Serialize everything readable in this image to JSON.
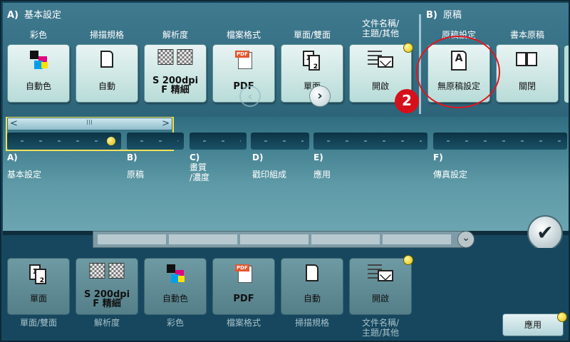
{
  "top": {
    "section_a": {
      "letter": "A)",
      "title": "基本設定"
    },
    "section_b": {
      "letter": "B)",
      "title": "原稿"
    },
    "buttons": [
      {
        "title": "彩色",
        "value": "自動色"
      },
      {
        "title": "掃描規格",
        "value": "自動"
      },
      {
        "title": "解析度",
        "value1": "S 200dpi",
        "value2": "F 精細"
      },
      {
        "title": "檔案格式",
        "value": "PDF",
        "icon_tag": "PDF"
      },
      {
        "title": "單面/雙面",
        "value": "單面",
        "icon_n1": "1",
        "icon_n2": "2"
      },
      {
        "title1": "文件名稱/",
        "title2": "主題/其他",
        "value": "開啟"
      },
      {
        "title": "原稿設定",
        "value": "無原稿設定",
        "icon_letter": "A"
      },
      {
        "title": "書本原稿",
        "value": "關閉"
      }
    ],
    "callout": "2"
  },
  "nav": {
    "scroll_left": "<",
    "scroll_grip": "III",
    "scroll_right": ">",
    "categories": [
      {
        "letter": "A)",
        "name": "基本設定"
      },
      {
        "letter": "B)",
        "name": "原稿"
      },
      {
        "letter": "C)",
        "name1": "畫質",
        "name2": "/濃度"
      },
      {
        "letter": "D)",
        "name": "戳印組成"
      },
      {
        "letter": "E)",
        "name": "應用"
      },
      {
        "letter": "F)",
        "name": "傳真設定"
      }
    ],
    "prev": "‹",
    "next": "›",
    "ok": "✔"
  },
  "bottom": {
    "buttons": [
      {
        "value": "單面",
        "caption": "單面/雙面",
        "icon_n1": "1",
        "icon_n2": "2"
      },
      {
        "value1": "S 200dpi",
        "value2": "F 精細",
        "caption": "解析度"
      },
      {
        "value": "自動色",
        "caption": "彩色"
      },
      {
        "value": "PDF",
        "caption": "檔案格式",
        "icon_tag": "PDF"
      },
      {
        "value": "自動",
        "caption": "掃描規格"
      },
      {
        "value": "開啟",
        "caption1": "文件名稱/",
        "caption2": "主題/其他"
      }
    ],
    "collapse": "⌄",
    "apply": "應用"
  },
  "colors": {
    "accent_yellow": "#f2e25a",
    "callout_red": "#d6101a",
    "panel_bg": "#17475e"
  }
}
